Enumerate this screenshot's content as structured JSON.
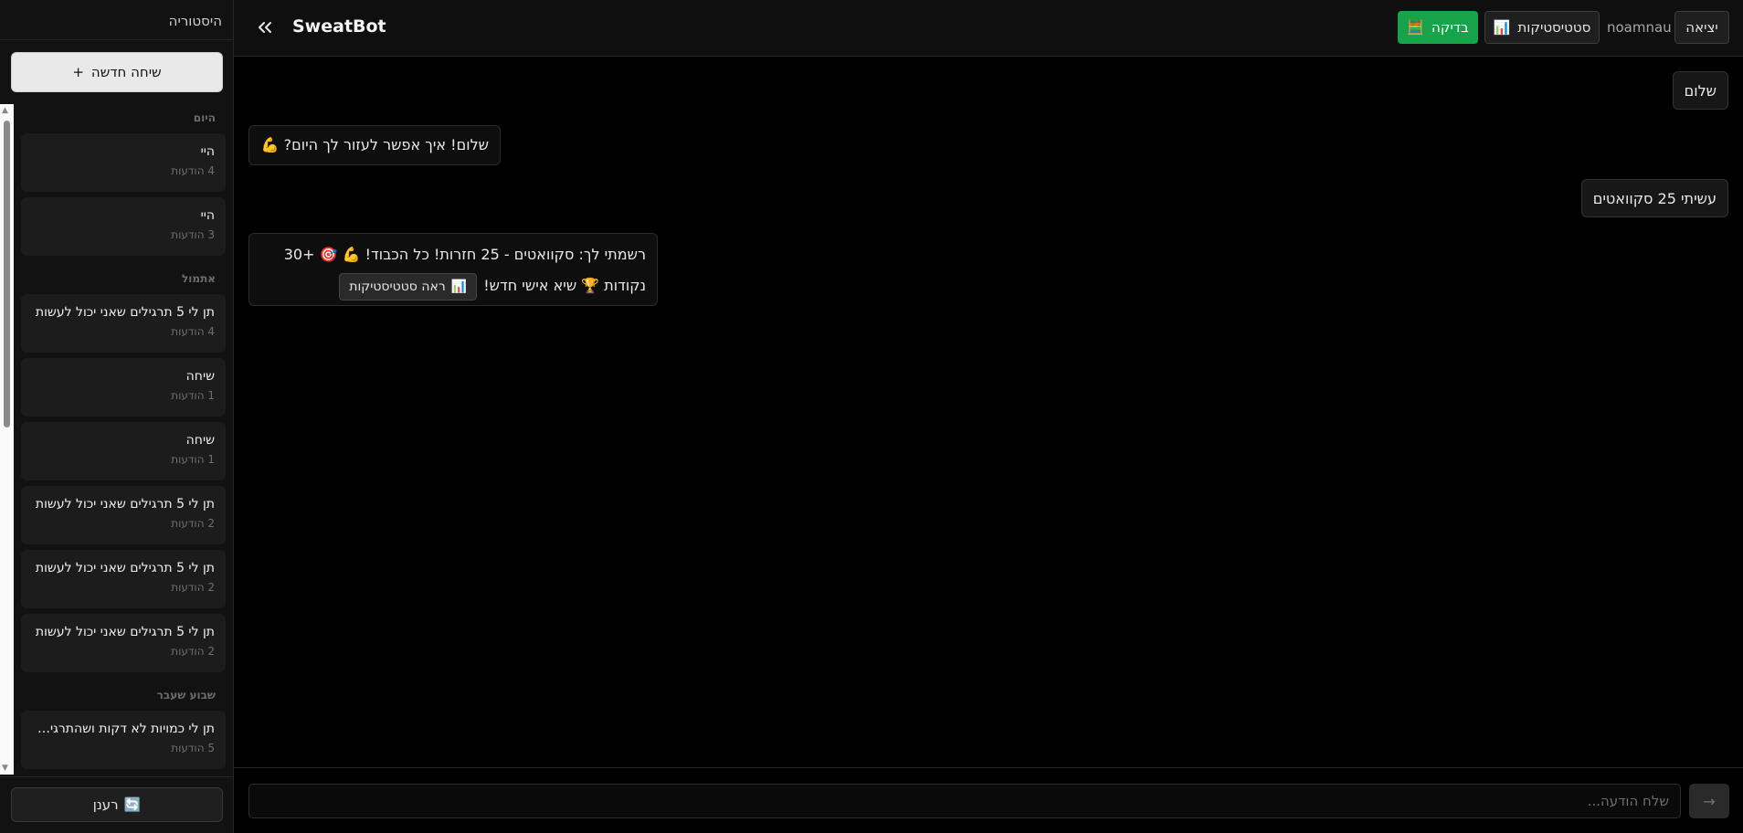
{
  "app": {
    "name": "SweatBot"
  },
  "header": {
    "check_label": "בדיקה",
    "check_icon": "🧮",
    "stats_label": "סטטיסטיקות",
    "stats_icon": "📊",
    "username": "noamnau",
    "exit_label": "יציאה"
  },
  "sidebar": {
    "title": "היסטוריה",
    "new_chat_label": "שיחה חדשה",
    "new_chat_icon": "+",
    "refresh_label": "רענן",
    "refresh_icon": "🔄",
    "groups": [
      {
        "label": "היום"
      },
      {
        "label": "אתמול"
      },
      {
        "label": "שבוע שעבר"
      }
    ],
    "conversations": [
      {
        "title": "היי",
        "count": "4 הודעות"
      },
      {
        "title": "היי",
        "count": "3 הודעות"
      },
      {
        "title": "תן לי 5 תרגילים שאני יכול לעשות",
        "count": "4 הודעות"
      },
      {
        "title": "שיחה",
        "count": "1 הודעות"
      },
      {
        "title": "שיחה",
        "count": "1 הודעות"
      },
      {
        "title": "תן לי 5 תרגילים שאני יכול לעשות",
        "count": "2 הודעות"
      },
      {
        "title": "תן לי 5 תרגילים שאני יכול לעשות",
        "count": "2 הודעות"
      },
      {
        "title": "תן לי 5 תרגילים שאני יכול לעשות",
        "count": "2 הודעות"
      },
      {
        "title": "תן לי כמויות לא דקות ושהתרגילים",
        "count": "5 הודעות"
      }
    ]
  },
  "chat": {
    "messages": [
      {
        "role": "user",
        "text": "שלום"
      },
      {
        "role": "bot",
        "text": "שלום! איך אפשר לעזור לך היום? 💪"
      },
      {
        "role": "user",
        "text": "עשיתי 25 סקוואטים"
      },
      {
        "role": "bot",
        "line1": "רשמתי לך: סקוואטים - 25 חזרות! כל הכבוד! 💪 🎯 +30",
        "line2": "נקודות 🏆 שיא אישי חדש!",
        "action_label": "ראה סטטיסטיקות",
        "action_icon": "📊"
      }
    ]
  },
  "composer": {
    "placeholder": "שלח הודעה...",
    "send_icon": "→"
  },
  "colors": {
    "accent_green": "#16a34a",
    "background": "#000000",
    "sidebar": "#121212"
  }
}
